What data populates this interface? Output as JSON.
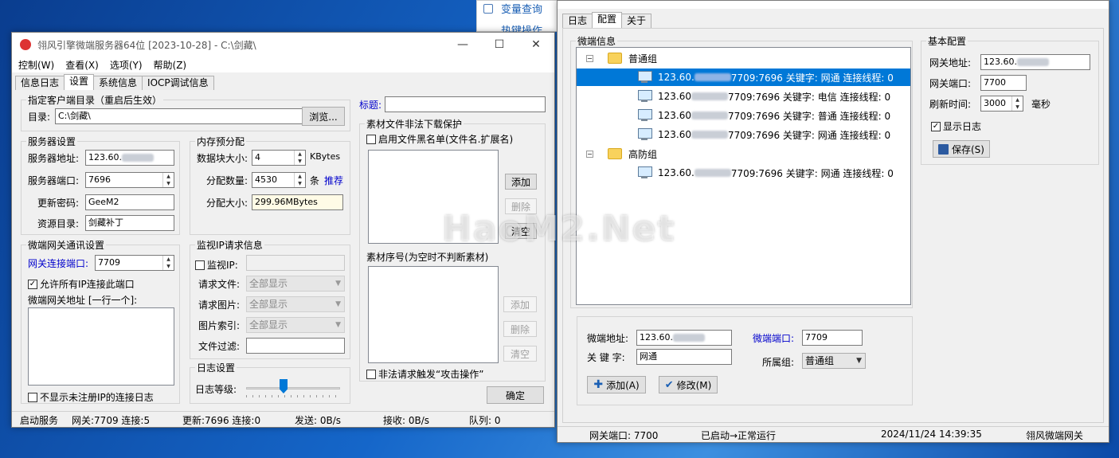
{
  "desktop": {
    "bg_window_link": "变量查询",
    "bg_window_link2": "热键操作"
  },
  "left": {
    "title": "翎风引擎微端服务器64位 [2023-10-28] - C:\\剑藏\\",
    "menu": [
      "控制(W)",
      "查看(X)",
      "选项(Y)",
      "帮助(Z)"
    ],
    "tabs": [
      "信息日志",
      "设置",
      "系统信息",
      "IOCP调试信息"
    ],
    "dir_group": "指定客户端目录（重启后生效）",
    "dir_label": "目录:",
    "dir_value": "C:\\剑藏\\",
    "browse": "浏览...",
    "server_group": "服务器设置",
    "server_addr_label": "服务器地址:",
    "server_addr_value": "123.60.",
    "server_port_label": "服务器端口:",
    "server_port_value": "7696",
    "update_pwd_label": "更新密码:",
    "update_pwd_value": "GeeM2",
    "res_dir_label": "资源目录:",
    "res_dir_value": "剑藏补丁",
    "mem_group": "内存预分配",
    "block_label": "数据块大小:",
    "block_value": "4",
    "block_unit": "KBytes",
    "count_label": "分配数量:",
    "count_value": "4530",
    "count_unit": "条",
    "recommend": "推荐",
    "size_label": "分配大小:",
    "size_value": "299.96MBytes",
    "gw_group": "微端网关通讯设置",
    "gw_port_label": "网关连接端口:",
    "gw_port_value": "7709",
    "allow_all": "允许所有IP连接此端口",
    "gw_addr_label": "微端网关地址 [一行一个]:",
    "no_unreg": "不显示未注册IP的连接日志",
    "monitor_group": "监视IP请求信息",
    "monitor_ip": "监视IP:",
    "req_file_label": "请求文件:",
    "req_file_value": "全部显示",
    "req_img_label": "请求图片:",
    "req_img_value": "全部显示",
    "img_idx_label": "图片索引:",
    "img_idx_value": "全部显示",
    "file_filter_label": "文件过滤:",
    "log_group": "日志设置",
    "log_level_label": "日志等级:",
    "title_label": "标题:",
    "protect_group": "素材文件非法下载保护",
    "blacklist": "启用文件黑名单(文件名.扩展名)",
    "add": "添加",
    "delete": "删除",
    "clear_partial": "清空",
    "seq_group": "素材序号(为空时不判断素材)",
    "add2": "添加",
    "delete2": "删除",
    "clear2": "清空",
    "trigger": "非法请求触发“攻击操作”",
    "ok": "确定",
    "status": [
      "启动服务",
      "网关:7709  连接:5",
      "更新:7696  连接:0",
      "发送: 0B/s",
      "接收: 0B/s",
      "队列: 0"
    ]
  },
  "right": {
    "tabs": [
      "日志",
      "配置",
      "关于"
    ],
    "clients_group": "微端信息",
    "groups": [
      {
        "name": "普通组",
        "items": [
          {
            "prefix": "123.60.",
            "suffix": "7709:7696 关键字: 网通 连接线程: 0",
            "selected": true
          },
          {
            "prefix": "123.60",
            "suffix": "7709:7696 关键字: 电信 连接线程: 0",
            "selected": false
          },
          {
            "prefix": "123.60",
            "suffix": "7709:7696 关键字: 普通 连接线程: 0",
            "selected": false
          },
          {
            "prefix": "123.60",
            "suffix": "7709:7696 关键字: 网通 连接线程: 0",
            "selected": false
          }
        ]
      },
      {
        "name": "高防组",
        "items": [
          {
            "prefix": "123.60.",
            "suffix": "7709:7696 关键字: 网通 连接线程: 0",
            "selected": false
          }
        ]
      }
    ],
    "basic_group": "基本配置",
    "gw_addr_label": "网关地址:",
    "gw_addr_value": "123.60.",
    "gw_port_label": "网关端口:",
    "gw_port_value": "7700",
    "refresh_label": "刷新时间:",
    "refresh_value": "3000",
    "refresh_unit": "毫秒",
    "show_log": "显示日志",
    "save": "保存(S)",
    "mc_addr_label": "微端地址:",
    "mc_addr_value": "123.60.",
    "mc_port_label": "微端端口:",
    "mc_port_value": "7709",
    "keyword_label": "关 键 字:",
    "keyword_value": "网通",
    "belong_label": "所属组:",
    "belong_value": "普通组",
    "add": "添加(A)",
    "modify": "修改(M)",
    "status": [
      "网关端口: 7700",
      "已启动→正常运行",
      "2024/11/24 14:39:35",
      "翎风微端网关"
    ]
  },
  "watermark": "HaoM2.Net",
  "colors": {
    "selection": "#0078d7",
    "link": "#0000cc"
  }
}
